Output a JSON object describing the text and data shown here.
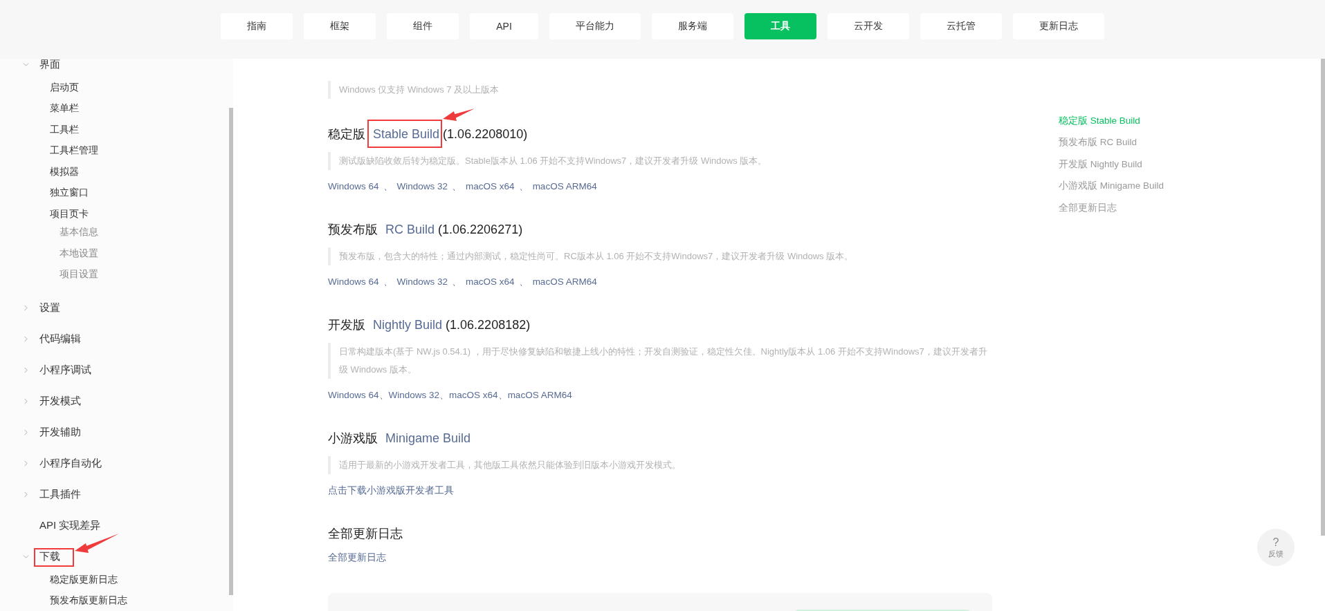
{
  "nav": [
    {
      "label": "指南",
      "selected": false
    },
    {
      "label": "框架",
      "selected": false
    },
    {
      "label": "组件",
      "selected": false
    },
    {
      "label": "API",
      "selected": false
    },
    {
      "label": "平台能力",
      "selected": false
    },
    {
      "label": "服务端",
      "selected": false
    },
    {
      "label": "工具",
      "selected": true
    },
    {
      "label": "云开发",
      "selected": false
    },
    {
      "label": "云托管",
      "selected": false
    },
    {
      "label": "更新日志",
      "selected": false
    }
  ],
  "sidebar": {
    "items": [
      {
        "label": "界面",
        "expanded": true,
        "children": [
          {
            "label": "启动页"
          },
          {
            "label": "菜单栏"
          },
          {
            "label": "工具栏"
          },
          {
            "label": "工具栏管理"
          },
          {
            "label": "模拟器"
          },
          {
            "label": "独立窗口"
          },
          {
            "label": "项目页卡",
            "children": [
              {
                "label": "基本信息"
              },
              {
                "label": "本地设置"
              },
              {
                "label": "项目设置"
              }
            ]
          }
        ]
      },
      {
        "label": "设置",
        "expanded": false
      },
      {
        "label": "代码编辑",
        "expanded": false
      },
      {
        "label": "小程序调试",
        "expanded": false
      },
      {
        "label": "开发模式",
        "expanded": false
      },
      {
        "label": "开发辅助",
        "expanded": false
      },
      {
        "label": "小程序自动化",
        "expanded": false
      },
      {
        "label": "工具插件",
        "expanded": false
      },
      {
        "label": "API 实现差异"
      },
      {
        "label": "下载",
        "expanded": true,
        "annotated": true,
        "children": [
          {
            "label": "稳定版更新日志"
          },
          {
            "label": "预发布版更新日志"
          }
        ]
      }
    ]
  },
  "content": {
    "intro_note": "Windows 仅支持 Windows 7 及以上版本",
    "sections": [
      {
        "heading": {
          "prefix": "稳定版",
          "link": "Stable Build",
          "version": "(1.06.2208010)",
          "annotated": true
        },
        "note": "测试版缺陷收敛后转为稳定版。Stable版本从 1.06 开始不支持Windows7，建议开发者升级 Windows 版本。",
        "compact": false,
        "links": [
          {
            "kind": "link",
            "text": "Windows 64"
          },
          {
            "kind": "sep",
            "text": "、"
          },
          {
            "kind": "link",
            "text": "Windows 32"
          },
          {
            "kind": "sep",
            "text": "、"
          },
          {
            "kind": "link",
            "text": "macOS x64"
          },
          {
            "kind": "sep",
            "text": "、"
          },
          {
            "kind": "link",
            "text": "macOS ARM64"
          }
        ]
      },
      {
        "heading": {
          "prefix": "预发布版",
          "link": "RC Build",
          "version": "(1.06.2206271)"
        },
        "note": "预发布版，包含大的特性；通过内部测试，稳定性尚可。RC版本从 1.06 开始不支持Windows7，建议开发者升级 Windows 版本。",
        "compact": false,
        "links": [
          {
            "kind": "link",
            "text": "Windows 64"
          },
          {
            "kind": "sep",
            "text": "、"
          },
          {
            "kind": "link",
            "text": "Windows 32"
          },
          {
            "kind": "sep",
            "text": "、"
          },
          {
            "kind": "link",
            "text": "macOS x64"
          },
          {
            "kind": "sep",
            "text": "、"
          },
          {
            "kind": "link",
            "text": "macOS ARM64"
          }
        ]
      },
      {
        "heading": {
          "prefix": "开发版",
          "link": "Nightly Build",
          "version": "(1.06.2208182)"
        },
        "note": "日常构建版本(基于 NW.js 0.54.1) ，用于尽快修复缺陷和敏捷上线小的特性；开发自测验证，稳定性欠佳。Nightly版本从 1.06 开始不支持Windows7，建议开发者升级 Windows 版本。",
        "compact": true,
        "links": [
          {
            "kind": "link",
            "text": "Windows 64"
          },
          {
            "kind": "sep",
            "text": "、"
          },
          {
            "kind": "link",
            "text": "Windows 32"
          },
          {
            "kind": "sep",
            "text": "、"
          },
          {
            "kind": "link",
            "text": "macOS x64"
          },
          {
            "kind": "sep",
            "text": "、"
          },
          {
            "kind": "link",
            "text": "macOS ARM64"
          }
        ]
      },
      {
        "heading": {
          "prefix": "小游戏版",
          "link": "Minigame Build"
        },
        "note": "适用于最新的小游戏开发者工具，其他版工具依然只能体验到旧版本小游戏开发模式。",
        "links": [
          {
            "kind": "link",
            "text": "点击下载小游戏版开发者工具"
          }
        ]
      },
      {
        "heading": {
          "prefix": "全部更新日志"
        },
        "links": [
          {
            "kind": "link",
            "text": "全部更新日志"
          }
        ]
      }
    ]
  },
  "toc": [
    {
      "label": "稳定版 Stable Build",
      "selected": true
    },
    {
      "label": "预发布版 RC Build",
      "selected": false
    },
    {
      "label": "开发版 Nightly Build",
      "selected": false
    },
    {
      "label": "小游戏版 Minigame Build",
      "selected": false
    },
    {
      "label": "全部更新日志",
      "selected": false
    }
  ],
  "feedback": {
    "symbol": "?",
    "label": "反馈"
  }
}
